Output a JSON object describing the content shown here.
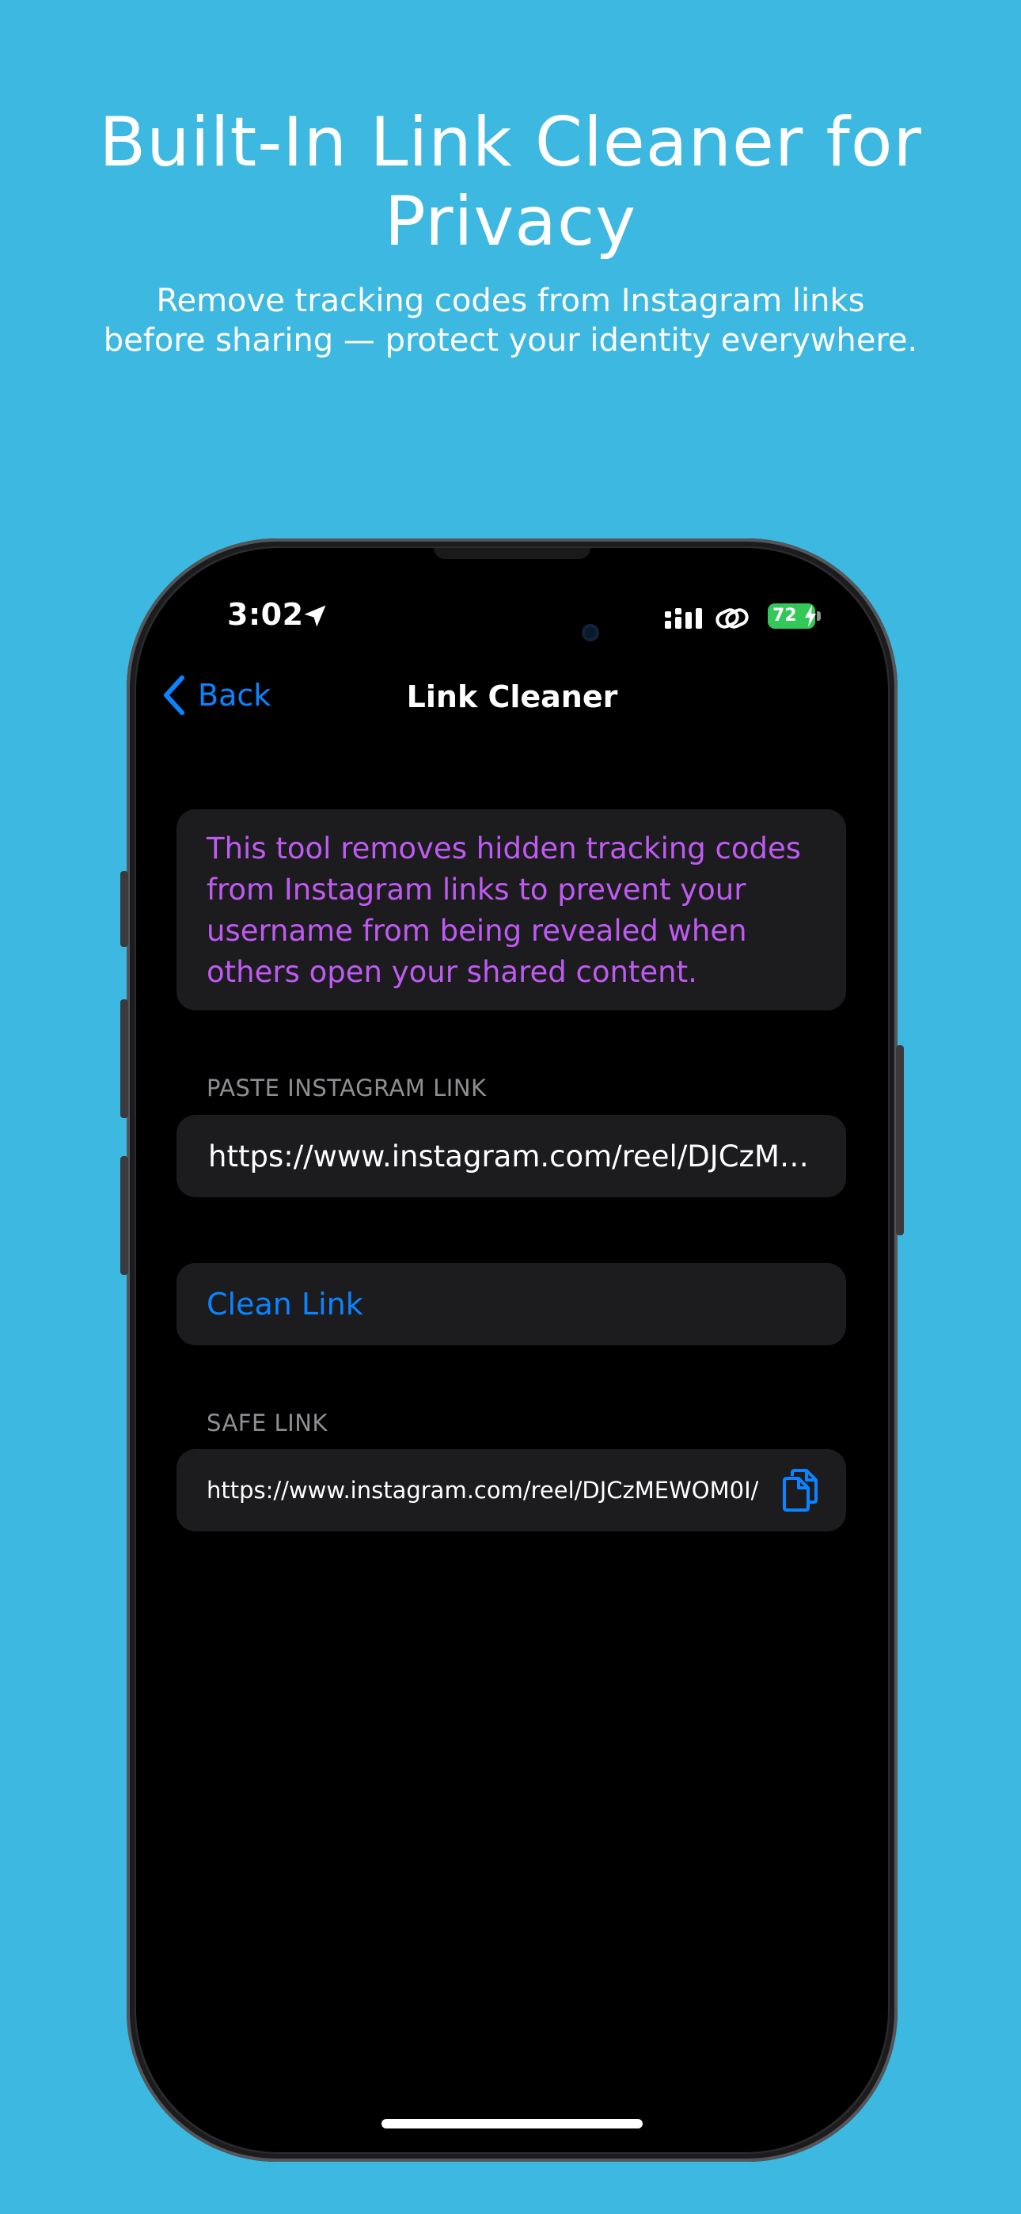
{
  "promo": {
    "title": "Built-In Link Cleaner for Privacy",
    "subtitle_line1": "Remove tracking codes from Instagram links",
    "subtitle_line2": "before sharing — protect your identity everywhere."
  },
  "status_bar": {
    "time": "3:02",
    "battery_level": "72",
    "icons": [
      "location-arrow-icon",
      "signal-icon",
      "link-icon",
      "battery-icon"
    ]
  },
  "nav": {
    "back_label": "Back",
    "title": "Link Cleaner"
  },
  "info": {
    "message": "This tool removes hidden tracking codes from Instagram links to prevent your username from being revealed when others open your shared content."
  },
  "paste_section": {
    "label": "PASTE INSTAGRAM LINK",
    "value": "https://www.instagram.com/reel/DJCzME…"
  },
  "actions": {
    "clean_label": "Clean Link"
  },
  "safe_section": {
    "label": "SAFE LINK",
    "value": "https://www.instagram.com/reel/DJCzMEWOM0I/"
  },
  "colors": {
    "background": "#3db8e0",
    "accent": "#0a84ff",
    "info_text": "#bf5af2",
    "card": "#1c1c1e",
    "battery": "#34c759"
  }
}
